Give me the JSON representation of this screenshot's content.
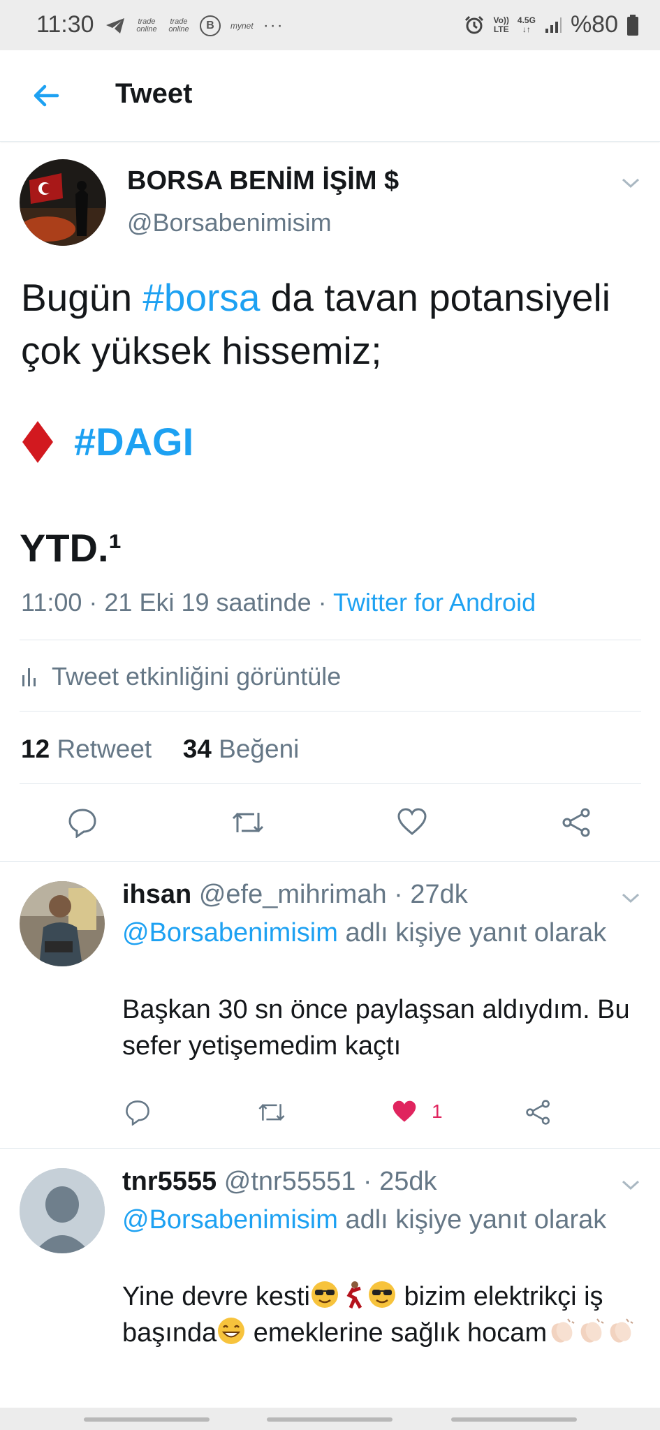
{
  "status_bar": {
    "time": "11:30",
    "chips": [
      "trade online",
      "trade online",
      "B",
      "mynet",
      "···"
    ],
    "network": "Vo) LTE",
    "data": "4.5G",
    "battery": "%80"
  },
  "header": {
    "title": "Tweet",
    "back_icon": "arrow-left-icon"
  },
  "main_tweet": {
    "name": "BORSA BENİM İŞİM $",
    "handle": "@Borsabenimisim",
    "text_part1": "Bugün ",
    "hashtag1": "#borsa",
    "text_part2": " da tavan potansiyeli çok yüksek hissemiz;",
    "hashtag2": "#DAGI",
    "ytd": "YTD.¹",
    "time": "11:00 · 21 Eki 19 saatinde · ",
    "source": "Twitter for Android",
    "activity_label": "Tweet etkinliğini görüntüle",
    "retweet_count": "12",
    "retweet_label": "Retweet",
    "like_count": "34",
    "like_label": "Beğeni"
  },
  "replies": [
    {
      "name": "ihsan",
      "handle": "@efe_mihrimah · 27dk",
      "mention": "@Borsabenimisim",
      "reply_suffix": " adlı kişiye yanıt olarak",
      "text": "Başkan 30 sn önce paylaşsan aldıydım. Bu sefer yetişemedim kaçtı",
      "likes": "1"
    },
    {
      "name": "tnr5555",
      "handle": "@tnr55551 · 25dk",
      "mention": "@Borsabenimisim",
      "reply_suffix": " adlı kişiye yanıt olarak",
      "text1": "Yine devre kesti",
      "text2": " bizim elektrikçi iş başında",
      "text3": " emeklerine sağlık hocam"
    }
  ],
  "colors": {
    "accent": "#1da1f2",
    "like": "#e0245e",
    "muted": "#657786",
    "text": "#14171a"
  }
}
